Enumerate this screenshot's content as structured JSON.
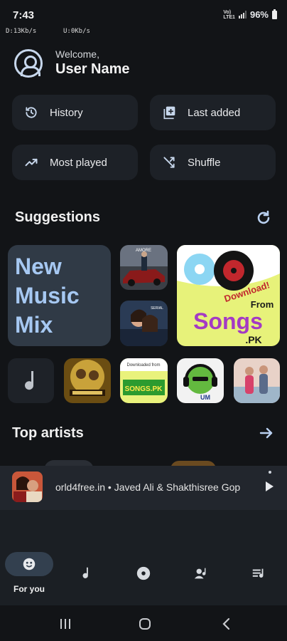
{
  "status_bar": {
    "time": "7:43",
    "net_down": "D:13Kb/s",
    "net_up": "U:0Kb/s",
    "battery": "96%",
    "network_label_top": "Vo)",
    "network_label_bottom": "LTE1"
  },
  "header": {
    "welcome": "Welcome,",
    "user_name": "User Name"
  },
  "quick_actions": [
    {
      "label": "History",
      "icon": "history-icon"
    },
    {
      "label": "Last added",
      "icon": "library-add-icon"
    },
    {
      "label": "Most played",
      "icon": "trending-up-icon"
    },
    {
      "label": "Shuffle",
      "icon": "shuffle-icon"
    }
  ],
  "suggestions": {
    "title": "Suggestions",
    "mix_card": "New Music Mix",
    "tiles": [
      {
        "name": "album-art-car",
        "text": "AMORE"
      },
      {
        "name": "album-art-couple",
        "text": "SERIAL"
      },
      {
        "name": "album-art-songspk-large",
        "text_top": "Download!",
        "text_mid": "From",
        "text_big": "Songs",
        "text_small": ".PK"
      },
      {
        "name": "placeholder-music-tile",
        "text": ""
      },
      {
        "name": "album-art-warrior",
        "text": ""
      },
      {
        "name": "album-art-songspk-small",
        "text_top": "Downloaded from",
        "text_big": "SONGS.PK"
      },
      {
        "name": "album-art-headphones",
        "text": "UM"
      },
      {
        "name": "album-art-dance",
        "text": ""
      }
    ]
  },
  "top_artists": {
    "title": "Top artists"
  },
  "mini_player": {
    "text": "orld4free.in • Javed Ali & Shakthisree Gop"
  },
  "bottom_nav": {
    "items": [
      {
        "label": "For you",
        "icon": "for-you-icon",
        "active": true
      },
      {
        "label": "",
        "icon": "songs-icon",
        "active": false
      },
      {
        "label": "",
        "icon": "albums-icon",
        "active": false
      },
      {
        "label": "",
        "icon": "artists-icon",
        "active": false
      },
      {
        "label": "",
        "icon": "playlists-icon",
        "active": false
      }
    ]
  },
  "colors": {
    "background": "#121417",
    "card": "#1d2127",
    "accent": "#a6c8f2",
    "mix_card": "#303a46"
  }
}
